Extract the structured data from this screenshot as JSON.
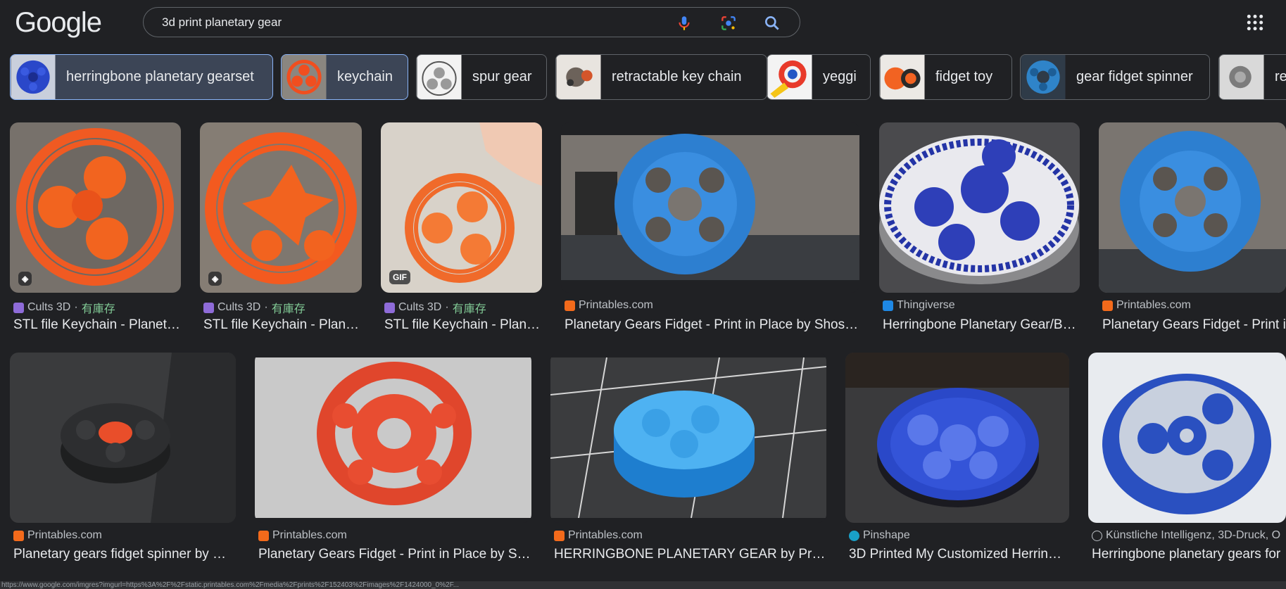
{
  "header": {
    "logo": "Google",
    "search_value": "3d print planetary gear",
    "icons": [
      "mic-icon",
      "lens-icon",
      "search-icon",
      "apps-icon"
    ]
  },
  "chips": [
    {
      "label": "herringbone planetary gearset",
      "selected": true
    },
    {
      "label": "keychain",
      "selected": true
    },
    {
      "label": "spur gear",
      "selected": false
    },
    {
      "label": "retractable key chain",
      "selected": false
    },
    {
      "label": "yeggi",
      "selected": false
    },
    {
      "label": "fidget toy",
      "selected": false
    },
    {
      "label": "gear fidget spinner",
      "selected": false
    },
    {
      "label": "re",
      "selected": false
    }
  ],
  "row1": [
    {
      "source": "Cults 3D",
      "stock": "有庫存",
      "title": "STL file Keychain - Planet…",
      "badge": "tag"
    },
    {
      "source": "Cults 3D",
      "stock": "有庫存",
      "title": "STL file Keychain - Plan…",
      "badge": "tag"
    },
    {
      "source": "Cults 3D",
      "stock": "有庫存",
      "title": "STL file Keychain - Plan…",
      "badge": "GIF"
    },
    {
      "source": "Printables.com",
      "stock": "",
      "title": "Planetary Gears Fidget - Print in Place by Shos…",
      "badge": ""
    },
    {
      "source": "Thingiverse",
      "stock": "",
      "title": "Herringbone Planetary Gear/B…",
      "badge": ""
    },
    {
      "source": "Printables.com",
      "stock": "",
      "title": "Planetary Gears Fidget - Print i",
      "badge": ""
    }
  ],
  "row2": [
    {
      "source": "Printables.com",
      "title": "Planetary gears fidget spinner by …"
    },
    {
      "source": "Printables.com",
      "title": "Planetary Gears Fidget - Print in Place by S…"
    },
    {
      "source": "Printables.com",
      "title": "HERRINGBONE PLANETARY GEAR by Prus…"
    },
    {
      "source": "Pinshape",
      "title": "3D Printed My Customized Herrin…"
    },
    {
      "source": "Künstliche Intelligenz, 3D-Druck, O",
      "title": "Herringbone planetary gears for"
    }
  ],
  "status_url": "https://www.google.com/imgres?imgurl=https%3A%2F%2Fstatic.printables.com%2Fmedia%2Fprints%2F152403%2Fimages%2F1424000_0%2F..."
}
